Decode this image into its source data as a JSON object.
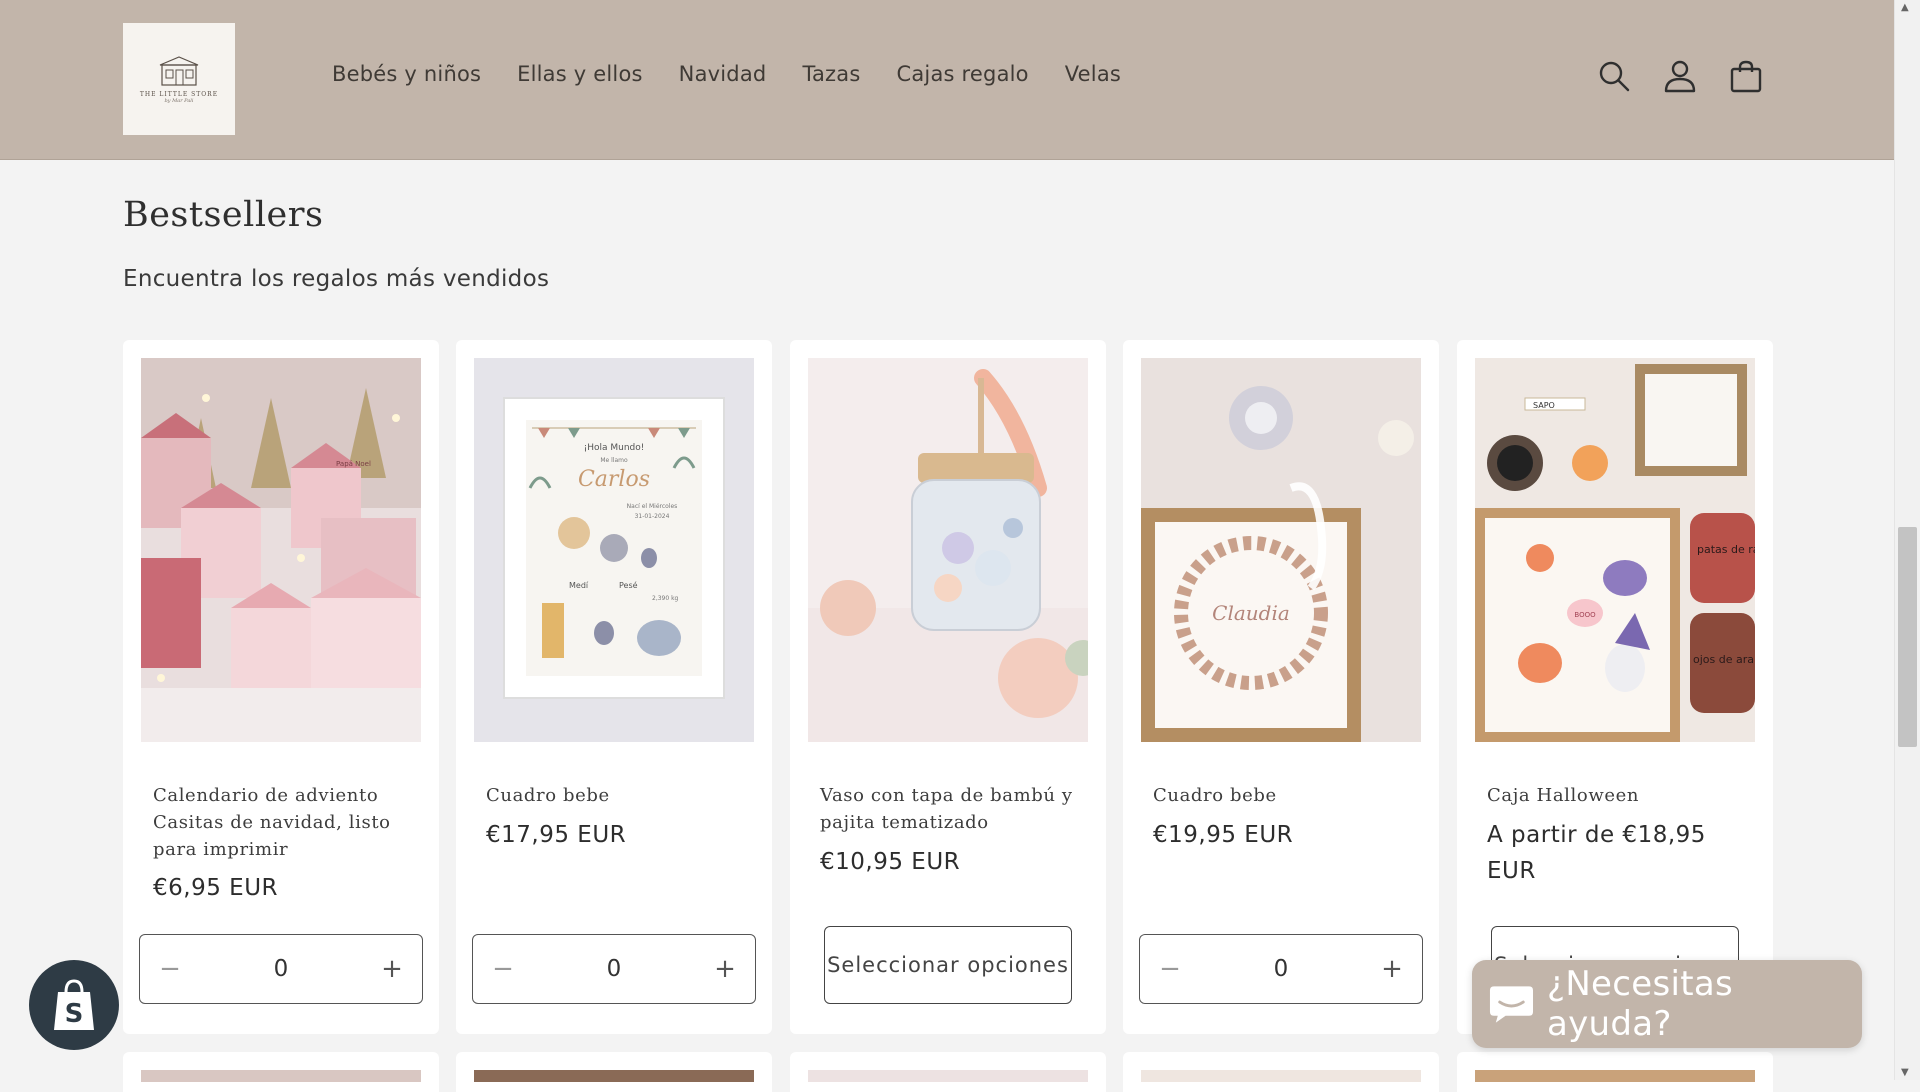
{
  "header": {
    "logo_text": "THE LITTLE STORE",
    "logo_sub": "by Mar Pali",
    "nav": [
      "Bebés y niños",
      "Ellas y ellos",
      "Navidad",
      "Tazas",
      "Cajas regalo",
      "Velas"
    ],
    "icons": [
      "search-icon",
      "account-icon",
      "cart-icon"
    ]
  },
  "section": {
    "title": "Bestsellers",
    "subtitle": "Encuentra los regalos más vendidos"
  },
  "products": [
    {
      "title": "Calendario de adviento Casitas de navidad, listo para imprimir",
      "price": "€6,95 EUR",
      "action": "quantity",
      "quantity": "0"
    },
    {
      "title": "Cuadro bebe",
      "price": "€17,95 EUR",
      "action": "quantity",
      "quantity": "0"
    },
    {
      "title": "Vaso con tapa de bambú y pajita tematizado",
      "price": "€10,95 EUR",
      "action": "options",
      "button": "Seleccionar opciones"
    },
    {
      "title": "Cuadro bebe",
      "price": "€19,95 EUR",
      "action": "quantity",
      "quantity": "0"
    },
    {
      "title": "Caja Halloween",
      "price": "A partir de €18,95 EUR",
      "action": "options",
      "button": "Seleccionar opciones"
    }
  ],
  "product_images": {
    "p1_label": "Papá Noel",
    "p2_lines": [
      "¡Hola Mundo!",
      "Me llamo",
      "Carlos",
      "Nací el Miércoles",
      "31-01-2024",
      "Medí",
      "Pesé",
      "2,390 kg"
    ],
    "p4_name": "Claudia",
    "p5_labels": [
      "SAPO",
      "patas de rana",
      "ojos de araña",
      "BOOO"
    ]
  },
  "chat": {
    "label": "¿Necesitas ayuda?"
  },
  "colors": {
    "header_bg": "#c2b5aa",
    "page_bg": "#f3f3f3",
    "card_bg": "#ffffff",
    "accent": "#c2b5aa"
  }
}
